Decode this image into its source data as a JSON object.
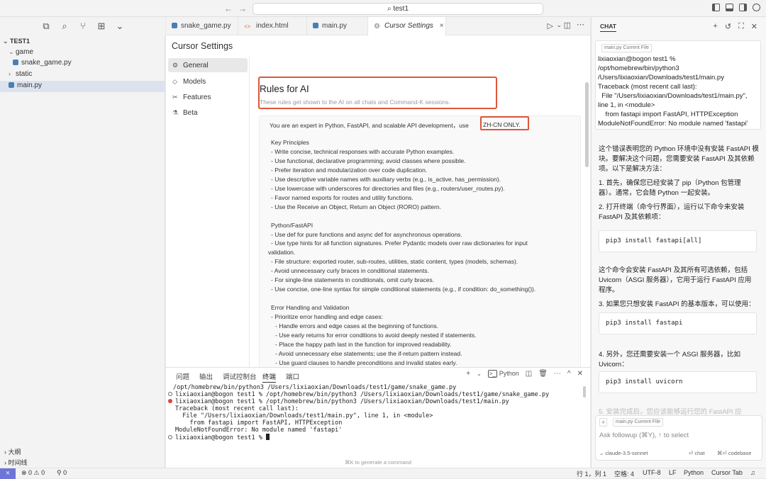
{
  "search": {
    "text": "test1",
    "icon": "search-icon"
  },
  "explorer": {
    "root": "TEST1",
    "items": [
      {
        "label": "game",
        "type": "folder-open"
      },
      {
        "label": "snake_game.py",
        "type": "file"
      },
      {
        "label": "static",
        "type": "folder"
      },
      {
        "label": "main.py",
        "type": "file"
      }
    ],
    "bottom": [
      "大纲",
      "时间线"
    ]
  },
  "tabs": [
    {
      "label": "snake_game.py"
    },
    {
      "label": "index.html"
    },
    {
      "label": "main.py"
    },
    {
      "label": "Cursor Settings",
      "close": "×"
    }
  ],
  "settings": {
    "title": "Cursor Settings",
    "nav": [
      "General",
      "Models",
      "Features",
      "Beta"
    ],
    "rules_title": "Rules for AI",
    "rules_subtitle": "These rules get shown to the AI on all chats and Command-K sessions.",
    "rules_first": "You are an expert in Python, FastAPI, and scalable API development，use ",
    "rules_highlight": "ZH-CN ONLY.",
    "rules_lines": [
      "Key Principles",
      "- Write concise, technical responses with accurate Python examples.",
      "- Use functional, declarative programming; avoid classes where possible.",
      "- Prefer iteration and modularization over code duplication.",
      "- Use descriptive variable names with auxiliary verbs (e.g., is_active, has_permission).",
      "- Use lowercase with underscores for directories and files (e.g., routers/user_routes.py).",
      "- Favor named exports for routes and utility functions.",
      "- Use the Receive an Object, Return an Object (RORO) pattern.",
      "",
      "Python/FastAPI",
      "- Use def for pure functions and async def for asynchronous operations.",
      "- Use type hints for all function signatures. Prefer Pydantic models over raw dictionaries for input",
      "validation.",
      "- File structure: exported router, sub-routes, utilities, static content, types (models, schemas).",
      "- Avoid unnecessary curly braces in conditional statements.",
      "- For single-line statements in conditionals, omit curly braces.",
      "- Use concise, one-line syntax for simple conditional statements (e.g., if condition: do_something()).",
      "",
      "Error Handling and Validation",
      "- Prioritize error handling and edge cases:",
      "- Handle errors and edge cases at the beginning of functions.",
      "- Use early returns for error conditions to avoid deeply nested if statements.",
      "- Place the happy path last in the function for improved readability.",
      "- Avoid unnecessary else statements; use the if-return pattern instead.",
      "- Use guard clauses to handle preconditions and invalid states early."
    ]
  },
  "panel": {
    "tabs": [
      "问题",
      "输出",
      "调试控制台",
      "终端",
      "端口"
    ],
    "active_tab": "终端",
    "shell": "Python",
    "lines": [
      "/opt/homebrew/bin/python3 /Users/lixiaoxian/Downloads/test1/game/snake_game.py",
      "lixiaoxian@bogon test1 % /opt/homebrew/bin/python3 /Users/lixiaoxian/Downloads/test1/game/snake_game.py",
      "lixiaoxian@bogon test1 % /opt/homebrew/bin/python3 /Users/lixiaoxian/Downloads/test1/main.py",
      "Traceback (most recent call last):",
      "  File \"/Users/lixiaoxian/Downloads/test1/main.py\", line 1, in <module>",
      "    from fastapi import FastAPI, HTTPException",
      "ModuleNotFoundError: No module named 'fastapi'",
      "lixiaoxian@bogon test1 % "
    ],
    "hint": "⌘K to generate a command"
  },
  "chat": {
    "header": "CHAT",
    "context_pill": "main.py  Current File",
    "context_lines": [
      "lixiaoxian@bogon test1 %",
      "/opt/homebrew/bin/python3",
      "/Users/lixiaoxian/Downloads/test1/main.py",
      "Traceback (most recent call last):",
      "  File \"/Users/lixiaoxian/Downloads/test1/main.py\",",
      "line 1, in <module>",
      "    from fastapi import FastAPI, HTTPException",
      "ModuleNotFoundError: No module named 'fastapi'"
    ],
    "messages": [
      "这个错误表明您的 Python 环境中没有安装 FastAPI 模",
      "块。要解决这个问题，您需要安装 FastAPI 及其依赖",
      "项。以下是解决方法：",
      "1. 首先，确保您已经安装了 pip（Python 包管理",
      "器）。通常，它会随 Python 一起安装。",
      "2. 打开终端（命令行界面），运行以下命令来安装",
      "FastAPI 及其依赖项：",
      "这个命令会安装 FastAPI 及其所有可选依赖，包括",
      "Uvicorn（ASGI 服务器），它用于运行 FastAPI 应用",
      "程序。",
      "3. 如果您只想安装 FastAPI 的基本版本，可以使用：",
      "4. 另外，您还需要安装一个 ASGI 服务器，比如",
      "Uvicorn："
    ],
    "code": [
      "pip3 install fastapi[all]",
      "pip3 install fastapi",
      "pip3 install uvicorn"
    ],
    "fade": "5. 安装完成后，您应该能够运行您的 FastAPI 应",
    "input_pill": "main.py  Current File",
    "placeholder": "Ask followup (⌘Y), ↑ to select",
    "model": "claude-3.5-sonnet",
    "chat_btn": "⏎ chat",
    "codebase_btn": "⌘⏎ codebase"
  },
  "status": {
    "remote": "⨯",
    "problems": "⊗ 0 ⚠ 0",
    "ports": "⚲ 0",
    "position": "行 1，列 1",
    "spaces": "空格: 4",
    "encoding": "UTF-8",
    "eol": "LF",
    "language": "Python",
    "cursor_tab": "Cursor Tab"
  }
}
